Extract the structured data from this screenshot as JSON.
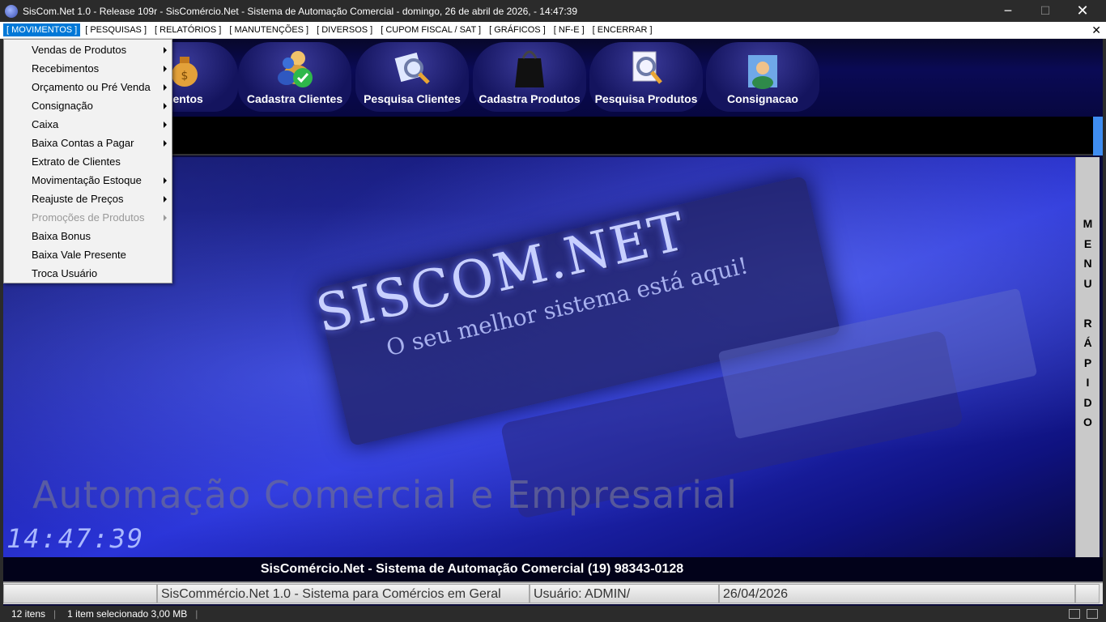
{
  "window": {
    "title": "SisCom.Net 1.0 - Release 109r - SisComércio.Net - Sistema de Automação Comercial -  domingo, 26  de  abril  de  2026,  - 14:47:39",
    "min": "─",
    "max": "☐",
    "close": "✕"
  },
  "menubar": {
    "items": [
      {
        "label": "[ MOVIMENTOS ]"
      },
      {
        "label": "[ PESQUISAS ]"
      },
      {
        "label": "[ RELATÓRIOS ]"
      },
      {
        "label": "[ MANUTENÇÕES ]"
      },
      {
        "label": "[ DIVERSOS ]"
      },
      {
        "label": "[ CUPOM FISCAL / SAT ]"
      },
      {
        "label": "[ GRÁFICOS ]"
      },
      {
        "label": "[ NF-E ]"
      },
      {
        "label": "[ ENCERRAR ]"
      }
    ],
    "close": "✕"
  },
  "toolbar": {
    "buttons": [
      {
        "label": "imentos"
      },
      {
        "label": "Cadastra Clientes"
      },
      {
        "label": "Pesquisa Clientes"
      },
      {
        "label": "Cadastra Produtos"
      },
      {
        "label": "Pesquisa Produtos"
      },
      {
        "label": "Consignacao"
      }
    ]
  },
  "dropdown": {
    "items": [
      {
        "label": "Vendas de Produtos",
        "submenu": true,
        "disabled": false
      },
      {
        "label": "Recebimentos",
        "submenu": true,
        "disabled": false
      },
      {
        "label": "Orçamento ou Pré Venda",
        "submenu": true,
        "disabled": false
      },
      {
        "label": "Consignação",
        "submenu": true,
        "disabled": false
      },
      {
        "label": "Caixa",
        "submenu": true,
        "disabled": false
      },
      {
        "label": "Baixa Contas a Pagar",
        "submenu": true,
        "disabled": false
      },
      {
        "label": "Extrato de Clientes",
        "submenu": false,
        "disabled": false
      },
      {
        "label": "Movimentação Estoque",
        "submenu": true,
        "disabled": false
      },
      {
        "label": "Reajuste de Preços",
        "submenu": true,
        "disabled": false
      },
      {
        "label": "Promoções de Produtos",
        "submenu": true,
        "disabled": true
      },
      {
        "label": "Baixa Bonus",
        "submenu": false,
        "disabled": false
      },
      {
        "label": "Baixa Vale Presente",
        "submenu": false,
        "disabled": false
      },
      {
        "label": "Troca Usuário",
        "submenu": false,
        "disabled": false
      }
    ]
  },
  "splash": {
    "brand": "SISCOM.NET",
    "slogan": "O seu melhor sistema está aqui!",
    "watermark": "Automação Comercial e Empresarial",
    "clock": "14:47:39"
  },
  "vmenu": {
    "letters": [
      "M",
      "E",
      "N",
      "U",
      "",
      "R",
      "Á",
      "P",
      "I",
      "D",
      "O"
    ]
  },
  "footer": {
    "text": "SisComércio.Net - Sistema de Automação Comercial (19) 98343-0128"
  },
  "statusbar": {
    "panel1": "",
    "panel2": "SisCommércio.Net 1.0 - Sistema para Comércios em Geral",
    "panel3": "Usuário: ADMIN/",
    "panel4": "26/04/2026",
    "panel5": ""
  },
  "explorer_status": {
    "items": "12 itens",
    "selected": "1 item selecionado  3,00 MB"
  },
  "colors": {
    "menu_active": "#0078d7",
    "toolbar_bg": "#0a0a55",
    "vmenu_bg": "#c9c9c9"
  }
}
